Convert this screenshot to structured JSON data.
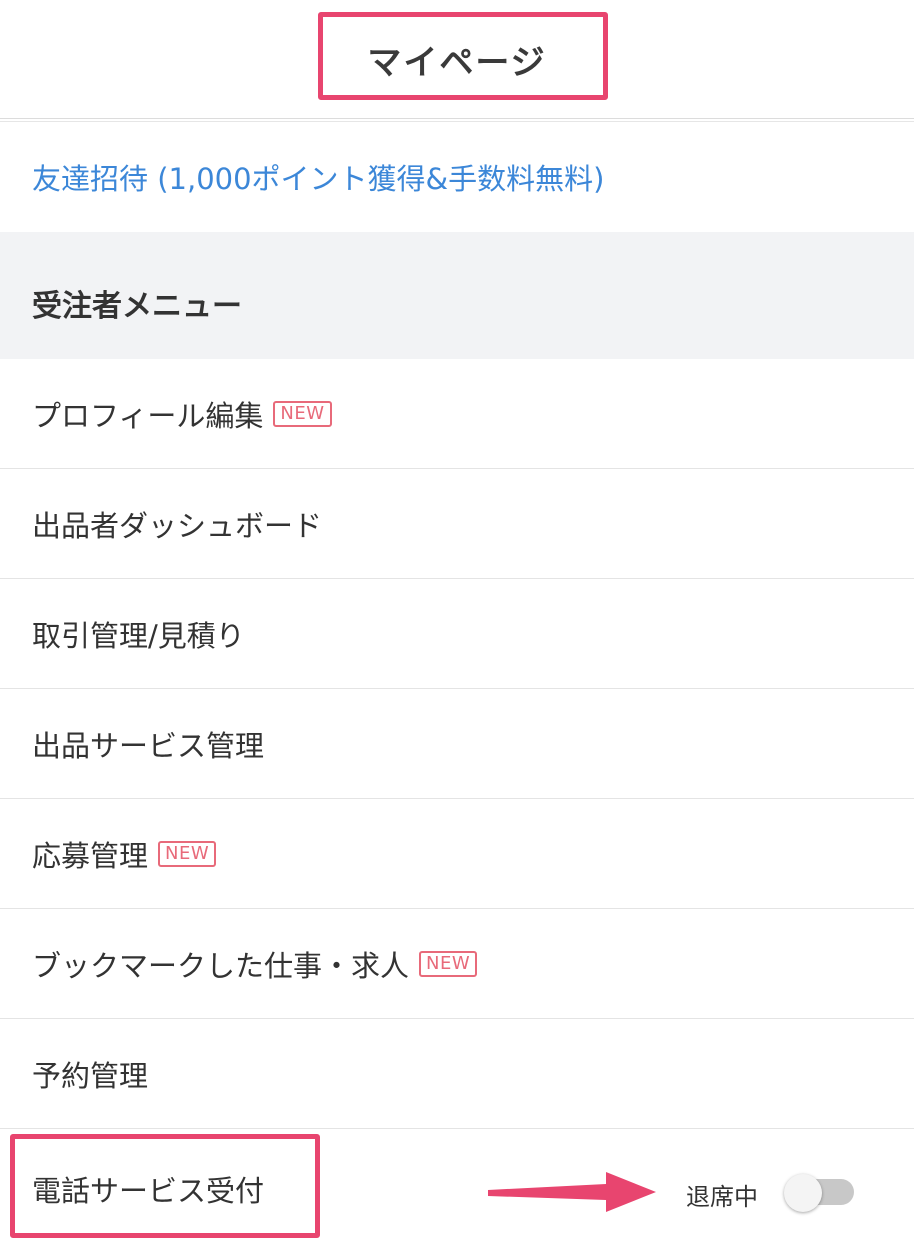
{
  "header": {
    "title": "マイページ"
  },
  "invite": {
    "label": "友達招待 (1,000ポイント獲得&手数料無料)"
  },
  "section": {
    "title": "受注者メニュー"
  },
  "menu": {
    "items": [
      {
        "label": "プロフィール編集",
        "badge": "NEW"
      },
      {
        "label": "出品者ダッシュボード"
      },
      {
        "label": "取引管理/見積り"
      },
      {
        "label": "出品サービス管理"
      },
      {
        "label": "応募管理",
        "badge": "NEW"
      },
      {
        "label": "ブックマークした仕事・求人",
        "badge": "NEW"
      },
      {
        "label": "予約管理"
      }
    ]
  },
  "phone": {
    "label": "電話サービス受付",
    "status": "退席中",
    "toggle_on": false
  },
  "colors": {
    "link": "#3c87d8",
    "badge": "#e86a7a",
    "highlight": "#e8456f",
    "section_bg": "#f2f3f5"
  }
}
